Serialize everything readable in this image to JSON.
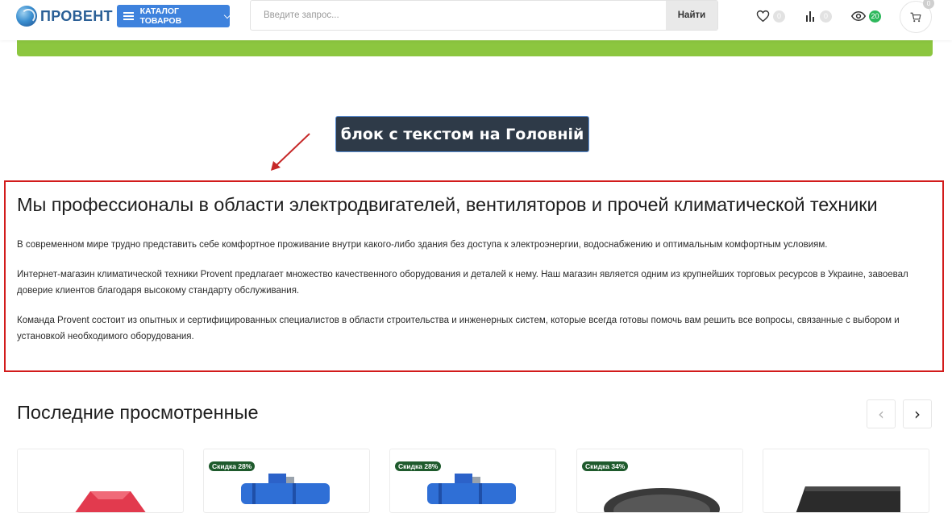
{
  "header": {
    "logo_text": "ПРОВЕНТ",
    "catalog_label": "КАТАЛОГ ТОВАРОВ",
    "search_placeholder": "Введите запрос...",
    "search_button": "Найти",
    "wishlist_count": "0",
    "compare_count": "0",
    "viewed_count": "20",
    "cart_count": "0"
  },
  "annotation": {
    "text": "блок с текстом на Головній"
  },
  "seo": {
    "title": "Мы профессионалы в области электродвигателей, вентиляторов и прочей климатической техники",
    "paragraphs": [
      "В современном мире трудно представить себе комфортное проживание внутри какого-либо здания без доступа к электроэнергии, водоснабжению и оптимальным комфортным условиям.",
      "Интернет-магазин климатической техники Provent предлагает множество качественного оборудования и деталей к нему. Наш магазин является одним из крупнейших торговых ресурсов в Украине, завоевал доверие клиентов благодаря высокому стандарту обслуживания.",
      "Команда Provent состоит из опытных и сертифицированных специалистов в области строительства и инженерных систем, которые всегда готовы помочь вам решить все вопросы, связанные с выбором и установкой необходимого оборудования."
    ]
  },
  "recent": {
    "title": "Последние просмотренные",
    "prev_symbol": "‹",
    "next_symbol": "›",
    "cards": [
      {
        "badge": ""
      },
      {
        "badge": "Скидка 28%"
      },
      {
        "badge": "Скидка 28%"
      },
      {
        "badge": "Скидка 34%"
      },
      {
        "badge": ""
      }
    ]
  },
  "colors": {
    "accent_blue": "#3e82dd",
    "green_bar": "#8cc63f",
    "highlight_red": "#d21b1b",
    "badge_green": "#1e5a2c"
  }
}
